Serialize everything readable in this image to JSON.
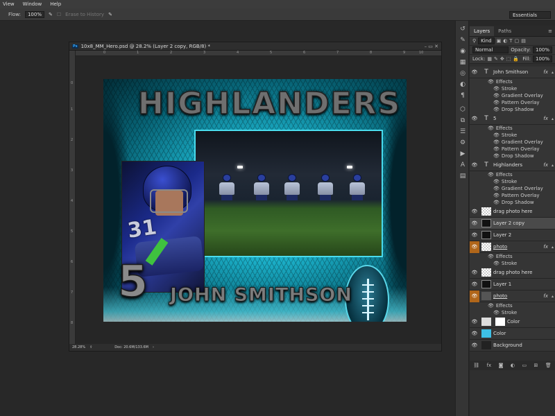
{
  "menu": [
    "View",
    "Window",
    "Help"
  ],
  "options": {
    "flow_label": "Flow:",
    "flow_value": "100%",
    "erase_to_history": "Erase to History",
    "workspace": "Essentials"
  },
  "document": {
    "tab_title": "10x8_MM_Hero.psd @ 28.2% (Layer 2 copy, RGB/8) *",
    "ps_badge": "Ps",
    "zoom": "28.28%",
    "doc_size": "Doc: 20.6M/133.6M",
    "ruler_h": [
      "0",
      "1",
      "2",
      "3",
      "4",
      "5",
      "6",
      "7",
      "8",
      "9",
      "10"
    ],
    "ruler_v": [
      "0",
      "1",
      "2",
      "3",
      "4",
      "5",
      "6",
      "7",
      "8"
    ]
  },
  "artwork": {
    "title": "HIGHLANDERS",
    "jersey_number": "5",
    "player_name": "JOHN SMITHSON",
    "portrait_number": "31",
    "colors": {
      "accent": "#1bb0c9",
      "glow": "#5fe8f5",
      "dark": "#022c36"
    }
  },
  "panel": {
    "tabs": [
      "Layers",
      "Paths"
    ],
    "kind": "Kind",
    "blend_mode": "Normal",
    "opacity_label": "Opacity:",
    "opacity_value": "100%",
    "lock_label": "Lock:",
    "fill_label": "Fill:",
    "fill_value": "100%",
    "layers": [
      {
        "type": "text",
        "name": "John Smithson",
        "fx": true
      },
      {
        "type": "text",
        "name": "5",
        "fx": true
      },
      {
        "type": "text",
        "name": "Highlanders",
        "fx": true
      },
      {
        "type": "pixel",
        "name": "drag photo here"
      },
      {
        "type": "pixel",
        "name": "Layer 2 copy",
        "selected": true
      },
      {
        "type": "pixel",
        "name": "Layer 2"
      },
      {
        "type": "pixel",
        "name": "photo",
        "fx": true
      },
      {
        "type": "pixel",
        "name": "drag photo here"
      },
      {
        "type": "pixel",
        "name": "Layer 1"
      },
      {
        "type": "pixel",
        "name": "photo",
        "fx": true
      },
      {
        "type": "adjust",
        "name": "Color"
      },
      {
        "type": "fill",
        "name": "Color"
      },
      {
        "type": "pixel",
        "name": "Background"
      }
    ],
    "effects_label": "Effects",
    "effects_text": [
      "Stroke",
      "Gradient Overlay",
      "Pattern Overlay",
      "Drop Shadow"
    ],
    "effects_stroke": "Stroke"
  }
}
